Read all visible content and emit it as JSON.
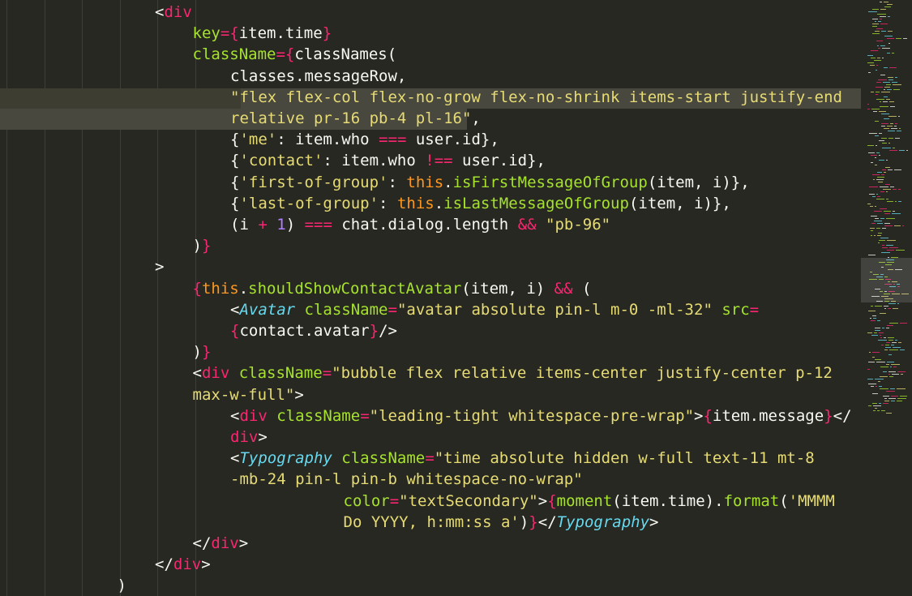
{
  "editor": {
    "theme_colors": {
      "background": "#272822",
      "keyword": "#f92672",
      "attribute": "#a6e22e",
      "string": "#e6db74",
      "number": "#ae81ff",
      "this": "#fd971f",
      "component": "#66d9ef",
      "plain": "#f8f8f2"
    },
    "lines": [
      {
        "indent": 4,
        "tokens": [
          [
            "t-plain",
            "<"
          ],
          [
            "t-tag",
            "div"
          ]
        ]
      },
      {
        "indent": 5,
        "tokens": [
          [
            "t-attr",
            "key"
          ],
          [
            "t-op",
            "="
          ],
          [
            "t-brace",
            "{"
          ],
          [
            "t-plain",
            "item.time"
          ],
          [
            "t-brace",
            "}"
          ]
        ]
      },
      {
        "indent": 5,
        "tokens": [
          [
            "t-attr",
            "className"
          ],
          [
            "t-op",
            "="
          ],
          [
            "t-brace",
            "{"
          ],
          [
            "t-plain",
            "classNames("
          ]
        ]
      },
      {
        "indent": 6,
        "tokens": [
          [
            "t-plain",
            "classes.messageRow,"
          ]
        ]
      },
      {
        "indent": 6,
        "tokens": [
          [
            "t-str",
            "\"flex flex-col flex-no-grow flex-no-shrink items-start justify-end"
          ]
        ]
      },
      {
        "indent": 6,
        "tokens": [
          [
            "t-str",
            "relative pr-16 pb-4 pl-16\""
          ],
          [
            "t-plain",
            ","
          ]
        ]
      },
      {
        "indent": 6,
        "tokens": [
          [
            "t-plain",
            "{"
          ],
          [
            "t-str",
            "'me'"
          ],
          [
            "t-plain",
            ": item.who "
          ],
          [
            "t-op",
            "==="
          ],
          [
            "t-plain",
            " user.id},"
          ]
        ]
      },
      {
        "indent": 6,
        "tokens": [
          [
            "t-plain",
            "{"
          ],
          [
            "t-str",
            "'contact'"
          ],
          [
            "t-plain",
            ": item.who "
          ],
          [
            "t-op",
            "!=="
          ],
          [
            "t-plain",
            " user.id},"
          ]
        ]
      },
      {
        "indent": 6,
        "tokens": [
          [
            "t-plain",
            "{"
          ],
          [
            "t-str",
            "'first-of-group'"
          ],
          [
            "t-plain",
            ": "
          ],
          [
            "t-this",
            "this"
          ],
          [
            "t-plain",
            "."
          ],
          [
            "t-fn",
            "isFirstMessageOfGroup"
          ],
          [
            "t-plain",
            "(item, i)},"
          ]
        ]
      },
      {
        "indent": 6,
        "tokens": [
          [
            "t-plain",
            "{"
          ],
          [
            "t-str",
            "'last-of-group'"
          ],
          [
            "t-plain",
            ": "
          ],
          [
            "t-this",
            "this"
          ],
          [
            "t-plain",
            "."
          ],
          [
            "t-fn",
            "isLastMessageOfGroup"
          ],
          [
            "t-plain",
            "(item, i)},"
          ]
        ]
      },
      {
        "indent": 6,
        "tokens": [
          [
            "t-plain",
            "(i "
          ],
          [
            "t-op",
            "+"
          ],
          [
            "t-plain",
            " "
          ],
          [
            "t-num",
            "1"
          ],
          [
            "t-plain",
            ") "
          ],
          [
            "t-op",
            "==="
          ],
          [
            "t-plain",
            " chat.dialog.length "
          ],
          [
            "t-op",
            "&&"
          ],
          [
            "t-plain",
            " "
          ],
          [
            "t-str",
            "\"pb-96\""
          ]
        ]
      },
      {
        "indent": 5,
        "tokens": [
          [
            "t-plain",
            ")"
          ],
          [
            "t-brace",
            "}"
          ]
        ]
      },
      {
        "indent": 4,
        "tokens": [
          [
            "t-plain",
            ">"
          ]
        ]
      },
      {
        "indent": 5,
        "tokens": [
          [
            "t-brace",
            "{"
          ],
          [
            "t-this",
            "this"
          ],
          [
            "t-plain",
            "."
          ],
          [
            "t-fn",
            "shouldShowContactAvatar"
          ],
          [
            "t-plain",
            "(item, i) "
          ],
          [
            "t-op",
            "&&"
          ],
          [
            "t-plain",
            " ("
          ]
        ]
      },
      {
        "indent": 6,
        "tokens": [
          [
            "t-plain",
            "<"
          ],
          [
            "t-comp",
            "Avatar"
          ],
          [
            "t-plain",
            " "
          ],
          [
            "t-attr",
            "className"
          ],
          [
            "t-op",
            "="
          ],
          [
            "t-str",
            "\"avatar absolute pin-l m-0 -ml-32\""
          ],
          [
            "t-plain",
            " "
          ],
          [
            "t-attr",
            "src"
          ],
          [
            "t-op",
            "="
          ]
        ]
      },
      {
        "indent": 6,
        "tokens": [
          [
            "t-brace",
            "{"
          ],
          [
            "t-plain",
            "contact.avatar"
          ],
          [
            "t-brace",
            "}"
          ],
          [
            "t-plain",
            "/>"
          ]
        ]
      },
      {
        "indent": 5,
        "tokens": [
          [
            "t-plain",
            ")"
          ],
          [
            "t-brace",
            "}"
          ]
        ]
      },
      {
        "indent": 5,
        "tokens": [
          [
            "t-plain",
            "<"
          ],
          [
            "t-tag",
            "div"
          ],
          [
            "t-plain",
            " "
          ],
          [
            "t-attr",
            "className"
          ],
          [
            "t-op",
            "="
          ],
          [
            "t-str",
            "\"bubble flex relative items-center justify-center p-12"
          ]
        ]
      },
      {
        "indent": 5,
        "tokens": [
          [
            "t-str",
            "max-w-full\""
          ],
          [
            "t-plain",
            ">"
          ]
        ]
      },
      {
        "indent": 6,
        "tokens": [
          [
            "t-plain",
            "<"
          ],
          [
            "t-tag",
            "div"
          ],
          [
            "t-plain",
            " "
          ],
          [
            "t-attr",
            "className"
          ],
          [
            "t-op",
            "="
          ],
          [
            "t-str",
            "\"leading-tight whitespace-pre-wrap\""
          ],
          [
            "t-plain",
            ">"
          ],
          [
            "t-brace",
            "{"
          ],
          [
            "t-plain",
            "item.message"
          ],
          [
            "t-brace",
            "}"
          ],
          [
            "t-plain",
            "</"
          ]
        ]
      },
      {
        "indent": 6,
        "tokens": [
          [
            "t-tag",
            "div"
          ],
          [
            "t-plain",
            ">"
          ]
        ]
      },
      {
        "indent": 6,
        "tokens": [
          [
            "t-plain",
            "<"
          ],
          [
            "t-comp",
            "Typography"
          ],
          [
            "t-plain",
            " "
          ],
          [
            "t-attr",
            "className"
          ],
          [
            "t-op",
            "="
          ],
          [
            "t-str",
            "\"time absolute hidden w-full text-11 mt-8"
          ]
        ]
      },
      {
        "indent": 6,
        "tokens": [
          [
            "t-str",
            "-mb-24 pin-l pin-b whitespace-no-wrap\""
          ]
        ]
      },
      {
        "indent": 9,
        "tokens": [
          [
            "t-attr",
            "color"
          ],
          [
            "t-op",
            "="
          ],
          [
            "t-str",
            "\"textSecondary\""
          ],
          [
            "t-plain",
            ">"
          ],
          [
            "t-brace",
            "{"
          ],
          [
            "t-fn",
            "moment"
          ],
          [
            "t-plain",
            "(item.time)."
          ],
          [
            "t-fn",
            "format"
          ],
          [
            "t-plain",
            "("
          ],
          [
            "t-str",
            "'MMMM"
          ]
        ]
      },
      {
        "indent": 9,
        "tokens": [
          [
            "t-str",
            "Do YYYY, h:mm:ss a'"
          ],
          [
            "t-plain",
            ")"
          ],
          [
            "t-brace",
            "}"
          ],
          [
            "t-plain",
            "</"
          ],
          [
            "t-comp",
            "Typography"
          ],
          [
            "t-plain",
            ">"
          ]
        ]
      },
      {
        "indent": 5,
        "tokens": [
          [
            "t-plain",
            "</"
          ],
          [
            "t-tag",
            "div"
          ],
          [
            "t-plain",
            ">"
          ]
        ]
      },
      {
        "indent": 4,
        "tokens": [
          [
            "t-plain",
            "</"
          ],
          [
            "t-tag",
            "div"
          ],
          [
            "t-plain",
            ">"
          ]
        ]
      },
      {
        "indent": 3,
        "tokens": [
          [
            "t-plain",
            ")"
          ]
        ]
      }
    ]
  }
}
